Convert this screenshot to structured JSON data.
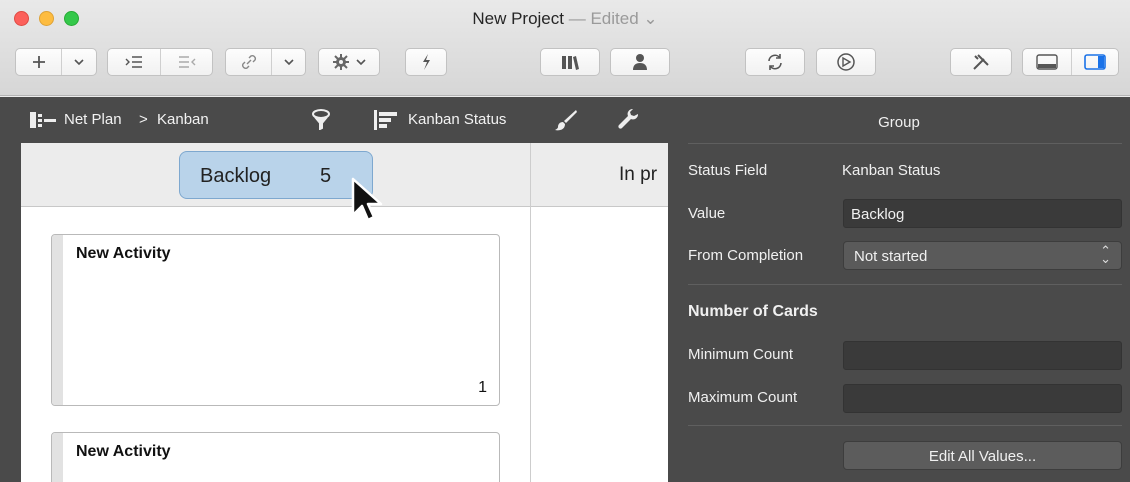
{
  "window": {
    "title": "New Project",
    "edited": "— Edited",
    "edited_chevron": "⌄"
  },
  "navbar": {
    "breadcrumb_root": "Net Plan",
    "breadcrumb_sep": ">",
    "breadcrumb_current": "Kanban",
    "status_field_label": "Kanban Status"
  },
  "board": {
    "columns": [
      {
        "name": "Backlog",
        "count": "5"
      },
      {
        "name": "In pr"
      }
    ],
    "cards": [
      {
        "title": "New Activity",
        "number": "1"
      },
      {
        "title": "New Activity",
        "number": ""
      }
    ]
  },
  "inspector": {
    "title": "Group",
    "status_field_label": "Status Field",
    "status_field_value": "Kanban Status",
    "value_label": "Value",
    "value": "Backlog",
    "from_completion_label": "From Completion",
    "from_completion_value": "Not started",
    "cards_section": "Number of Cards",
    "min_label": "Minimum Count",
    "min_value": "",
    "max_label": "Maximum Count",
    "max_value": "",
    "edit_button": "Edit All Values..."
  },
  "colors": {
    "selection_fill": "#b9d3ea",
    "inspector_bg": "#4a4a4a"
  }
}
